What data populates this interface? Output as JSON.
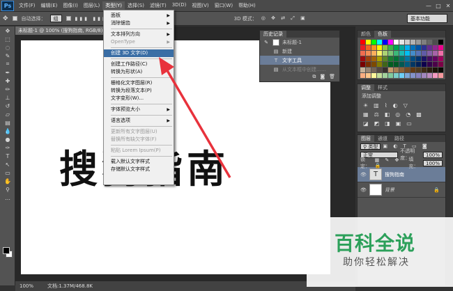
{
  "app": {
    "logo": "Ps"
  },
  "menubar": {
    "items": [
      "文件(F)",
      "编辑(E)",
      "图像(I)",
      "图层(L)",
      "类型(Y)",
      "选择(S)",
      "滤镜(T)",
      "3D(D)",
      "视图(V)",
      "窗口(W)",
      "帮助(H)"
    ],
    "active_index": 4,
    "controls": [
      "—",
      "□",
      "✕"
    ]
  },
  "options_bar": {
    "auto_select_label": "自动选择：",
    "auto_select_value": "组",
    "mode_3d_label": "3D 模式：",
    "workspace": "基本功能"
  },
  "document": {
    "tab_title": "未标题-1 @ 100% (搜狗指南, RGB/8)",
    "canvas_text": "搜狗指南",
    "zoom": "100%",
    "doc_info": "文档:1.37M/468.8K"
  },
  "type_menu": {
    "items": [
      {
        "label": "面板",
        "submenu": true
      },
      {
        "label": "消除锯齿",
        "submenu": true
      },
      {
        "sep": true
      },
      {
        "label": "文本排列方向",
        "submenu": true
      },
      {
        "label": "OpenType",
        "submenu": true,
        "disabled": true
      },
      {
        "sep": true
      },
      {
        "label": "创建 3D 文字(D)",
        "highlight": true
      },
      {
        "sep": true
      },
      {
        "label": "创建工作路径(C)"
      },
      {
        "label": "转换为形状(A)"
      },
      {
        "sep": true
      },
      {
        "label": "栅格化文字图层(R)"
      },
      {
        "label": "转换为段落文本(P)"
      },
      {
        "label": "文字变形(W)..."
      },
      {
        "sep": true
      },
      {
        "label": "字体预览大小",
        "submenu": true
      },
      {
        "sep": true
      },
      {
        "label": "语言选项",
        "submenu": true
      },
      {
        "sep": true
      },
      {
        "label": "更新所有文字图层(U)",
        "disabled": true
      },
      {
        "label": "替换所有缺欠字体(F)",
        "disabled": true
      },
      {
        "sep": true
      },
      {
        "label": "粘贴 Lorem Ipsum(P)",
        "disabled": true
      },
      {
        "sep": true
      },
      {
        "label": "载入默认文字样式"
      },
      {
        "label": "存储默认文字样式"
      }
    ]
  },
  "history_panel": {
    "tab": "历史记录",
    "document": "未标题-1",
    "entries": [
      "新建",
      "文字工具",
      "从文本框中创建……"
    ]
  },
  "swatches_panel": {
    "tabs": [
      "颜色",
      "色板"
    ]
  },
  "adjustments_panel": {
    "tabs": [
      "调整",
      "样式"
    ],
    "title": "添加调整"
  },
  "layers_panel": {
    "tabs": [
      "图层",
      "通道",
      "路径"
    ],
    "kind_label": "类型",
    "blend_mode": "正常",
    "opacity_label": "不透明度：",
    "opacity": "100%",
    "lock_label": "锁定：",
    "fill_label": "填充：",
    "fill": "100%",
    "layers": [
      {
        "name": "搜狗指南",
        "type": "text",
        "selected": true
      },
      {
        "name": "背景",
        "type": "background",
        "selected": false
      }
    ]
  },
  "watermark": {
    "title": "百科全说",
    "subtitle": "助你轻松解决"
  },
  "colors": {
    "accent_arrow": "#e8323c",
    "highlight": "#3a6ea5",
    "watermark_green": "#2ca05a"
  }
}
